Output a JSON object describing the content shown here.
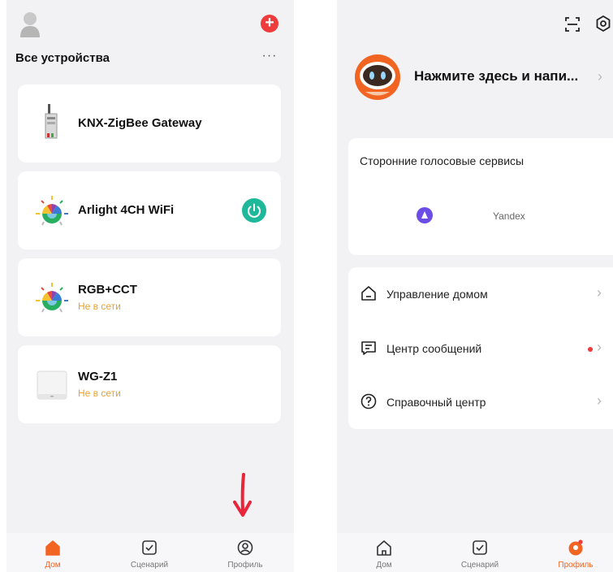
{
  "left_screen": {
    "section_title": "Все устройства",
    "more_label": "···",
    "add_label": "+",
    "devices": [
      {
        "name": "KNX-ZigBee Gateway",
        "status": "",
        "icon": "gateway-icon",
        "has_power": false
      },
      {
        "name": "Arlight 4CH WiFi",
        "status": "",
        "icon": "rgb-bulb-icon",
        "has_power": true
      },
      {
        "name": "RGB+CCT",
        "status": "Не в сети",
        "icon": "rgb-bulb-icon",
        "has_power": false
      },
      {
        "name": "WG-Z1",
        "status": "Не в сети",
        "icon": "hub-icon",
        "has_power": false
      }
    ],
    "tabs": [
      {
        "label": "Дом",
        "icon": "home-icon",
        "active": true
      },
      {
        "label": "Сценарий",
        "icon": "checkbox-icon",
        "active": false
      },
      {
        "label": "Профиль",
        "icon": "profile-icon",
        "active": false
      }
    ]
  },
  "right_screen": {
    "prompt": "Нажмите здесь и напи...",
    "voice_services": {
      "title": "Сторонние голосовые сервисы",
      "yandex_label": "Yandex"
    },
    "menu": [
      {
        "label": "Управление домом",
        "icon": "home-outline-icon",
        "badge": false
      },
      {
        "label": "Центр сообщений",
        "icon": "message-icon",
        "badge": true
      },
      {
        "label": "Справочный центр",
        "icon": "help-icon",
        "badge": false
      }
    ],
    "tabs": [
      {
        "label": "Дом",
        "icon": "home-icon",
        "active": false
      },
      {
        "label": "Сценарий",
        "icon": "checkbox-icon",
        "active": false
      },
      {
        "label": "Профиль",
        "icon": "profile-icon",
        "active": true
      }
    ]
  },
  "colors": {
    "accent": "#f26422",
    "offline": "#f0a020",
    "power_on": "#1fb89a",
    "badge": "#ee3b3b",
    "annotation_arrow": "#e8253a"
  }
}
